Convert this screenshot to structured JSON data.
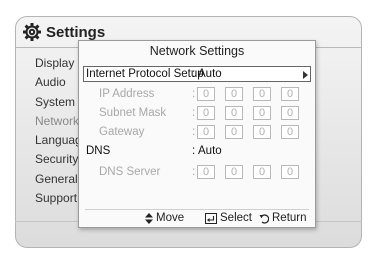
{
  "header": {
    "title": "Settings",
    "icon": "gear-icon"
  },
  "menu": [
    "Display",
    "Audio",
    "System",
    "Network",
    "Language",
    "Security",
    "General",
    "Support"
  ],
  "dialog": {
    "title": "Network Settings",
    "ipsetup": {
      "label": "Internet Protocol Setup",
      "colon": ":",
      "value": "Auto"
    },
    "ip": {
      "label": "IP Address",
      "colon": ":",
      "octets": [
        "0",
        "0",
        "0",
        "0"
      ]
    },
    "mask": {
      "label": "Subnet Mask",
      "colon": ":",
      "octets": [
        "0",
        "0",
        "0",
        "0"
      ]
    },
    "gateway": {
      "label": "Gateway",
      "colon": ":",
      "octets": [
        "0",
        "0",
        "0",
        "0"
      ]
    },
    "dns": {
      "label": "DNS",
      "colon": ":",
      "value": "Auto"
    },
    "dnsserver": {
      "label": "DNS Server",
      "colon": ":",
      "octets": [
        "0",
        "0",
        "0",
        "0"
      ]
    },
    "footer": {
      "move": "Move",
      "select": "Select",
      "return": "Return"
    }
  }
}
